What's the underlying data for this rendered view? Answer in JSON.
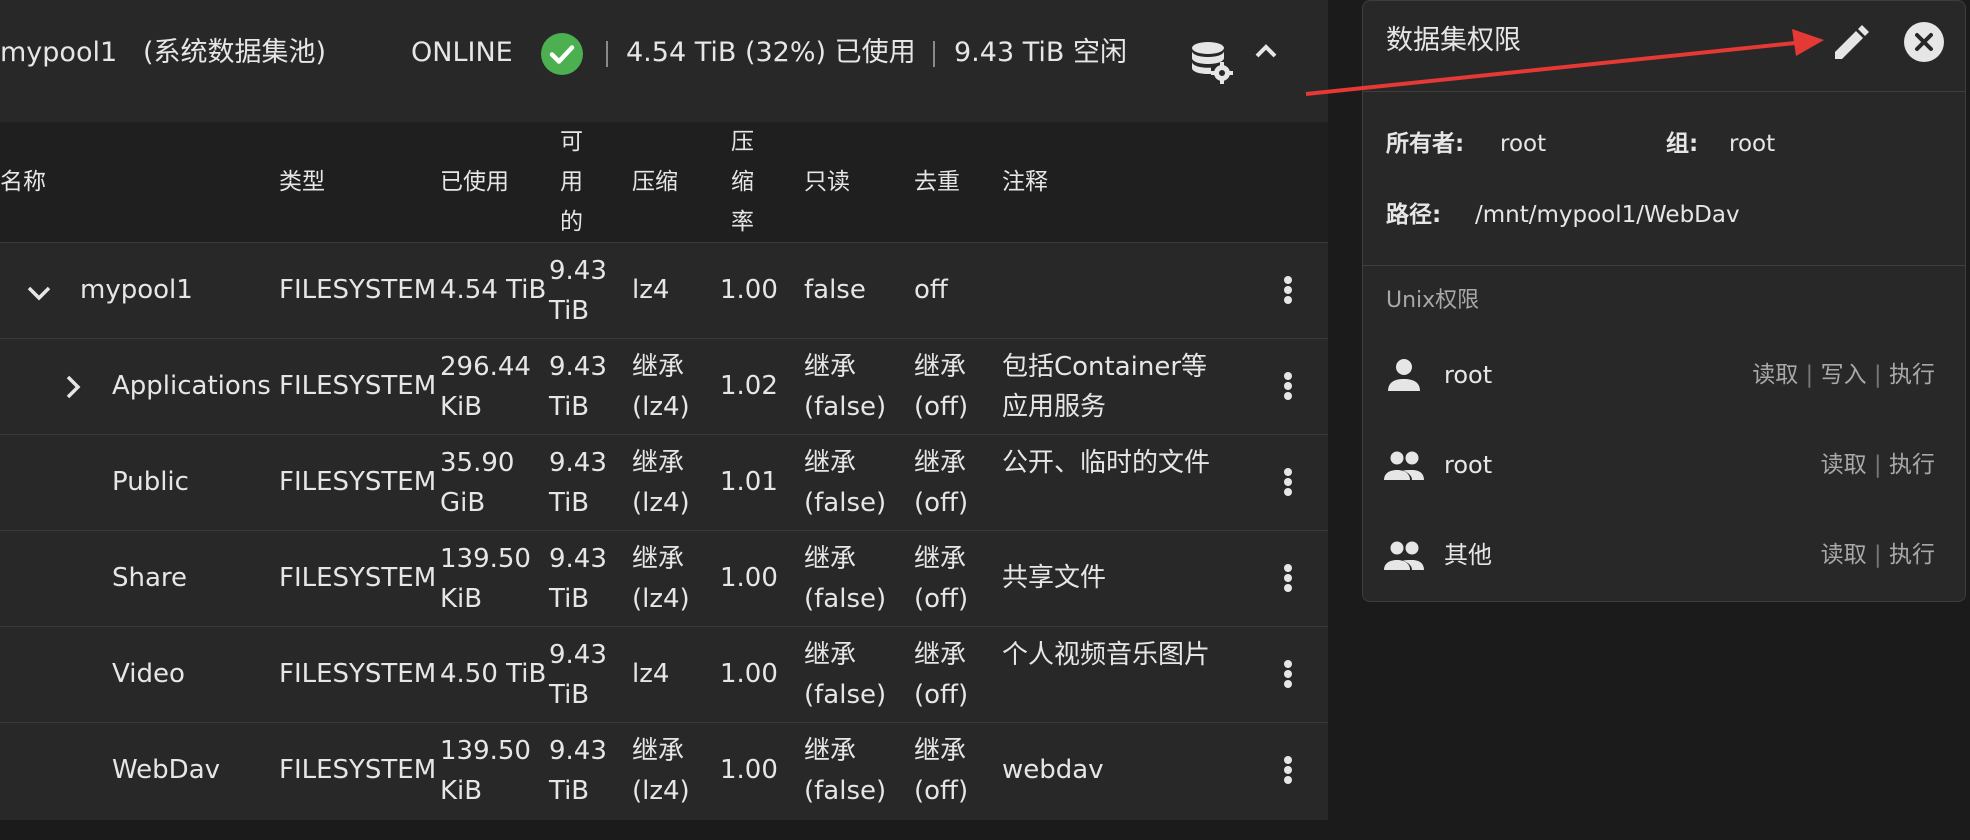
{
  "pool": {
    "name": "mypool1",
    "system_tag": "(系统数据集池)",
    "status": "ONLINE",
    "used": "4.54 TiB (32%) 已使用",
    "free": "9.43 TiB 空闲"
  },
  "table": {
    "headers": {
      "name": "名称",
      "type": "类型",
      "used": "已使用",
      "available": "可用的",
      "compression": "压缩",
      "ratio": "压缩率",
      "readonly": "只读",
      "dedup": "去重",
      "comment": "注释"
    },
    "rows": [
      {
        "name": "mypool1",
        "type": "FILESYSTEM",
        "used": "4.54 TiB",
        "avail": "9.43 TiB",
        "compression": "lz4",
        "ratio": "1.00",
        "readonly": "false",
        "dedup": "off",
        "comment": ""
      },
      {
        "name": "Applications",
        "type": "FILESYSTEM",
        "used": "296.44 KiB",
        "avail": "9.43 TiB",
        "compression": "继承 (lz4)",
        "ratio": "1.02",
        "readonly": "继承 (false)",
        "dedup": "继承 (off)",
        "comment": "包括Container等应用服务"
      },
      {
        "name": "Public",
        "type": "FILESYSTEM",
        "used": "35.90 GiB",
        "avail": "9.43 TiB",
        "compression": "继承 (lz4)",
        "ratio": "1.01",
        "readonly": "继承 (false)",
        "dedup": "继承 (off)",
        "comment": "公开、临时的文件"
      },
      {
        "name": "Share",
        "type": "FILESYSTEM",
        "used": "139.50 KiB",
        "avail": "9.43 TiB",
        "compression": "继承 (lz4)",
        "ratio": "1.00",
        "readonly": "继承 (false)",
        "dedup": "继承 (off)",
        "comment": "共享文件"
      },
      {
        "name": "Video",
        "type": "FILESYSTEM",
        "used": "4.50 TiB",
        "avail": "9.43 TiB",
        "compression": "lz4",
        "ratio": "1.00",
        "readonly": "继承 (false)",
        "dedup": "继承 (off)",
        "comment": "个人视频音乐图片"
      },
      {
        "name": "WebDav",
        "type": "FILESYSTEM",
        "used": "139.50 KiB",
        "avail": "9.43 TiB",
        "compression": "继承 (lz4)",
        "ratio": "1.00",
        "readonly": "继承 (false)",
        "dedup": "继承 (off)",
        "comment": "webdav"
      }
    ]
  },
  "permissions": {
    "title": "数据集权限",
    "owner_label": "所有者:",
    "owner": "root",
    "group_label": "组:",
    "group": "root",
    "path_label": "路径:",
    "path": "/mnt/mypool1/WebDav",
    "unix_label": "Unix权限",
    "entries": [
      {
        "icon": "user-icon",
        "name": "root",
        "rights": [
          "读取",
          "写入",
          "执行"
        ]
      },
      {
        "icon": "group-icon",
        "name": "root",
        "rights": [
          "读取",
          "执行"
        ]
      },
      {
        "icon": "group-icon",
        "name": "其他",
        "rights": [
          "读取",
          "执行"
        ]
      }
    ]
  },
  "icons": {
    "status": "check-circle-icon",
    "dataset_settings": "database-gear-icon",
    "collapse": "chevron-up-icon",
    "edit": "pencil-icon",
    "close": "close-circle-icon"
  },
  "colors": {
    "background": "#1b1b1b",
    "card": "#282828",
    "header_row": "#1f1f1f",
    "online_green": "#4caf50",
    "annotation_red": "#e53935"
  }
}
